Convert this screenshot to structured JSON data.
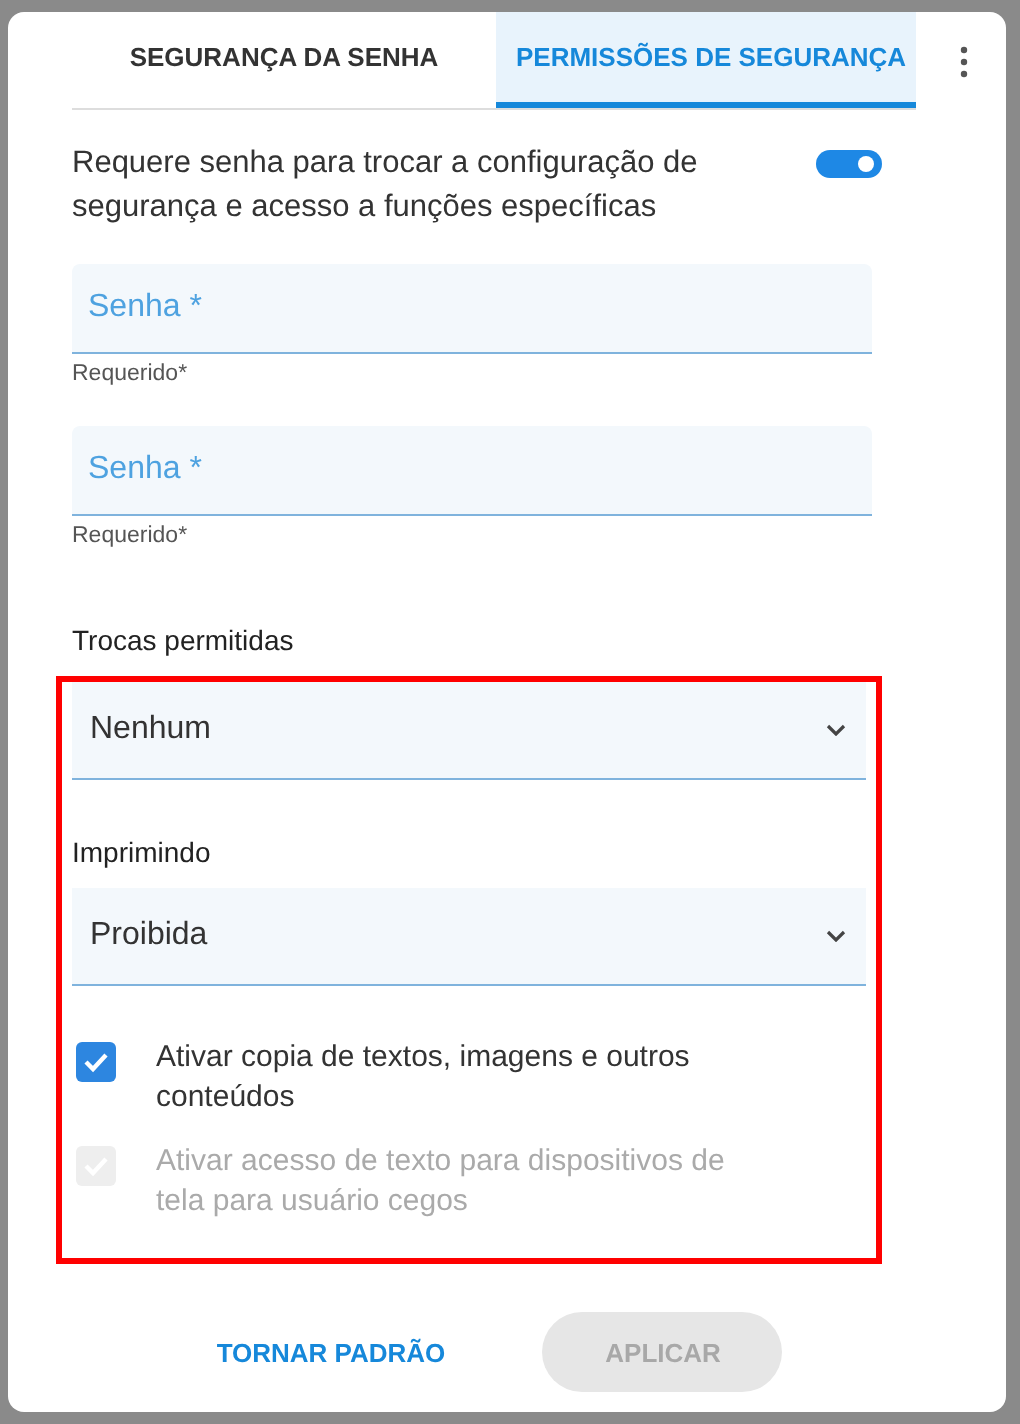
{
  "tabs": [
    {
      "label": "SEGURANÇA DA SENHA",
      "selected": false
    },
    {
      "label": "PERMISSÕES DE SEGURANÇA",
      "selected": true
    }
  ],
  "require_password": {
    "label": "Requere senha para trocar a configuração de segurança e acesso a funções específicas",
    "on": true
  },
  "password_fields": [
    {
      "placeholder": "Senha *",
      "helper": "Requerido*"
    },
    {
      "placeholder": "Senha *",
      "helper": "Requerido*"
    }
  ],
  "highlighted_section": {
    "label_before": "Trocas permitidas",
    "selects": [
      {
        "value": "Nenhum"
      },
      {
        "label": "Imprimindo",
        "value": "Proibida"
      }
    ],
    "checkboxes": [
      {
        "label": "Ativar copia de textos, imagens e outros conteúdos",
        "checked": true,
        "disabled": false
      },
      {
        "label": "Ativar acesso de texto para dispositivos de tela para usuário cegos",
        "checked": true,
        "disabled": true
      }
    ]
  },
  "buttons": [
    {
      "label": "TORNAR PADRÃO",
      "kind": "text",
      "disabled": false
    },
    {
      "label": "APLICAR",
      "kind": "filled",
      "disabled": true
    }
  ]
}
